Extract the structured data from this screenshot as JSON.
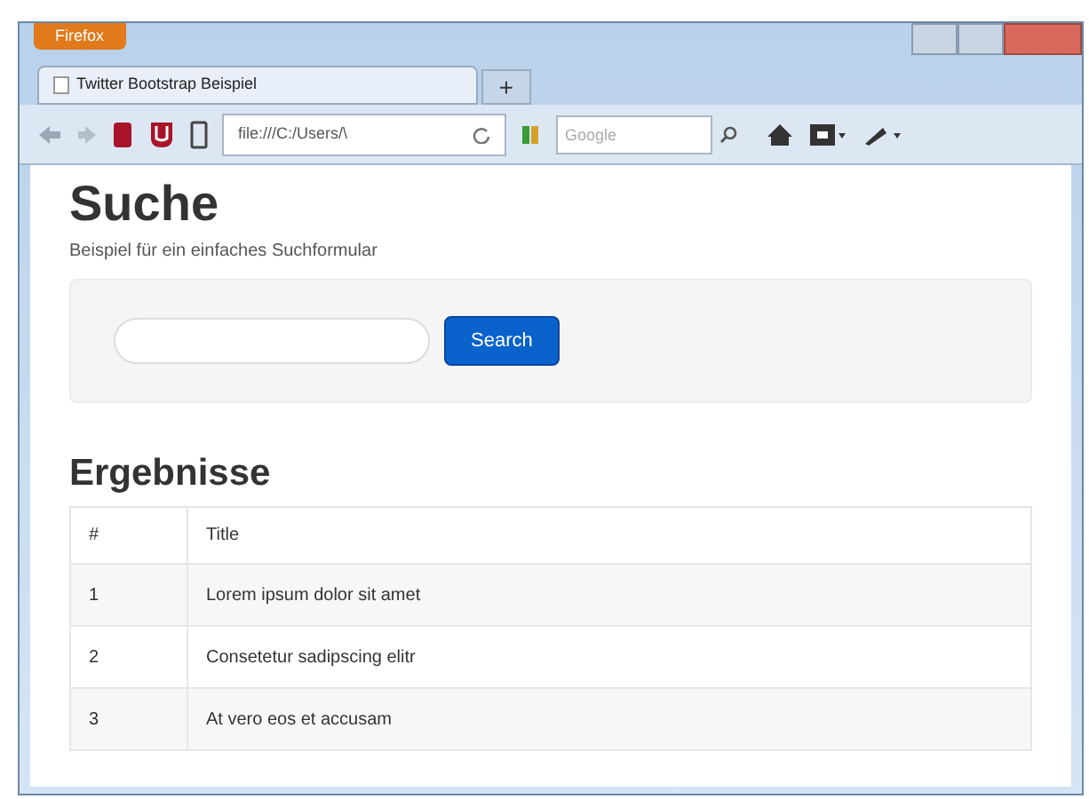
{
  "browser": {
    "app_button": "Firefox",
    "tabs": [
      {
        "label": "Twitter Bootstrap Beispiel",
        "selected": true
      }
    ],
    "new_tab": "+",
    "address": "file:///C:/Users/\\",
    "search_placeholder": "Google"
  },
  "page": {
    "title": "Suche",
    "subtitle": "Beispiel für ein einfaches Suchformular",
    "search": {
      "button": "Search"
    },
    "results_title": "Ergebnisse",
    "table": {
      "columns": [
        "#",
        "Title"
      ],
      "rows": [
        [
          "1",
          "Lorem ipsum dolor sit amet"
        ],
        [
          "2",
          "Consetetur sadipscing elitr"
        ],
        [
          "3",
          "At vero eos et accusam"
        ]
      ]
    }
  }
}
